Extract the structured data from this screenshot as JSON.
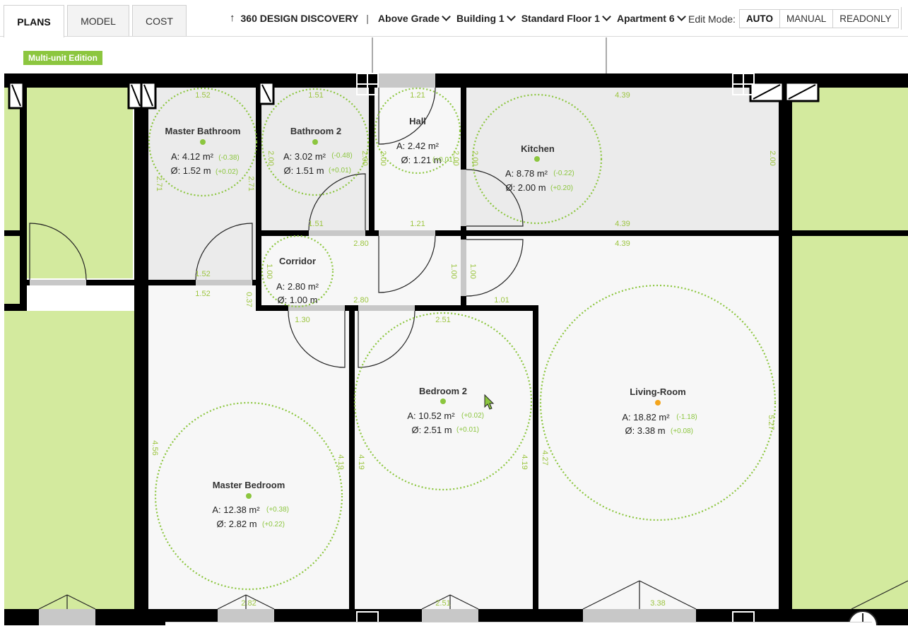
{
  "tabs": [
    {
      "label": "PLANS",
      "active": true
    },
    {
      "label": "MODEL",
      "active": false
    },
    {
      "label": "COST",
      "active": false
    }
  ],
  "breadcrumb": {
    "project": "360 DESIGN DISCOVERY",
    "separator": "|",
    "levels": [
      "Above Grade",
      "Building 1",
      "Standard Floor 1",
      "Apartment 6"
    ]
  },
  "edit_mode": {
    "label": "Edit Mode:",
    "options": [
      "AUTO",
      "MANUAL",
      "READONLY"
    ],
    "selected": "AUTO"
  },
  "edition_badge": "Multi-unit Edition",
  "colors": {
    "accent": "#8cc63f",
    "dimension": "#9cc540",
    "wall": "#000000",
    "room_wet": "#ebebeb",
    "room_dry": "#f7f7f7",
    "exterior": "#d3ea9e",
    "warning_dot": "#f4a51c"
  },
  "rooms": [
    {
      "id": "master-bathroom",
      "name": "Master Bathroom",
      "area": "A: 4.12 m²",
      "area_delta": "(-0.38)",
      "diam": "Ø: 1.52 m",
      "diam_delta": "(+0.02)",
      "dot": "green"
    },
    {
      "id": "bathroom-2",
      "name": "Bathroom 2",
      "area": "A: 3.02 m²",
      "area_delta": "(-0.48)",
      "diam": "Ø: 1.51 m",
      "diam_delta": "(+0.01)",
      "dot": "green"
    },
    {
      "id": "hall",
      "name": "Hall",
      "area": "A: 2.42 m²",
      "area_delta": "",
      "diam": "Ø: 1.21 m",
      "diam_delta": "(+0.01)",
      "dot": "green"
    },
    {
      "id": "kitchen",
      "name": "Kitchen",
      "area": "A: 8.78 m²",
      "area_delta": "(-0.22)",
      "diam": "Ø: 2.00 m",
      "diam_delta": "(+0.20)",
      "dot": "green"
    },
    {
      "id": "corridor",
      "name": "Corridor",
      "area": "A: 2.80 m²",
      "area_delta": "",
      "diam": "Ø: 1.00 m",
      "diam_delta": "",
      "dot": "green"
    },
    {
      "id": "bedroom-2",
      "name": "Bedroom 2",
      "area": "A: 10.52 m²",
      "area_delta": "(+0.02)",
      "diam": "Ø: 2.51 m",
      "diam_delta": "(+0.01)",
      "dot": "green"
    },
    {
      "id": "living-room",
      "name": "Living-Room",
      "area": "A: 18.82 m²",
      "area_delta": "(-1.18)",
      "diam": "Ø: 3.38 m",
      "diam_delta": "(+0.08)",
      "dot": "orange"
    },
    {
      "id": "master-bedroom",
      "name": "Master Bedroom",
      "area": "A: 12.38 m²",
      "area_delta": "(+0.38)",
      "diam": "Ø: 2.82 m",
      "diam_delta": "(+0.22)",
      "dot": "green"
    }
  ],
  "dimensions": {
    "mb_top": "1.52",
    "b2_top": "1.51",
    "hall_top": "1.21",
    "kit_top": "4.39",
    "mb_left": "2.71",
    "mb_right": "2.71",
    "b2_left": "2.00",
    "b2_right": "2.00",
    "hall_left": "2.00",
    "hall_right": "2.00",
    "kit_left": "2.00",
    "kit_right": "2.00",
    "b2_bottom": "1.51",
    "hall_bottom": "1.21",
    "kit_bottom": "4.39",
    "corr_top": "2.80",
    "liv_top": "4.39",
    "mb_door_a": "1.52",
    "mb_door_b": "1.52",
    "mb_door_c": "0.37",
    "corr_left": "1.00",
    "corr_right": "1.00",
    "corr_right2": "1.00",
    "corr_bottom": "2.80",
    "mbed_top": "1.30",
    "bed2_top": "2.51",
    "liv_step": "1.01",
    "mbed_left": "4.56",
    "mbed_right": "4.19",
    "bed2_left": "4.19",
    "bed2_right": "4.19",
    "liv_left": "4.27",
    "liv_right": "5.27",
    "mbed_bottom": "2.82",
    "bed2_bottom": "2.51",
    "liv_bottom": "3.38"
  }
}
